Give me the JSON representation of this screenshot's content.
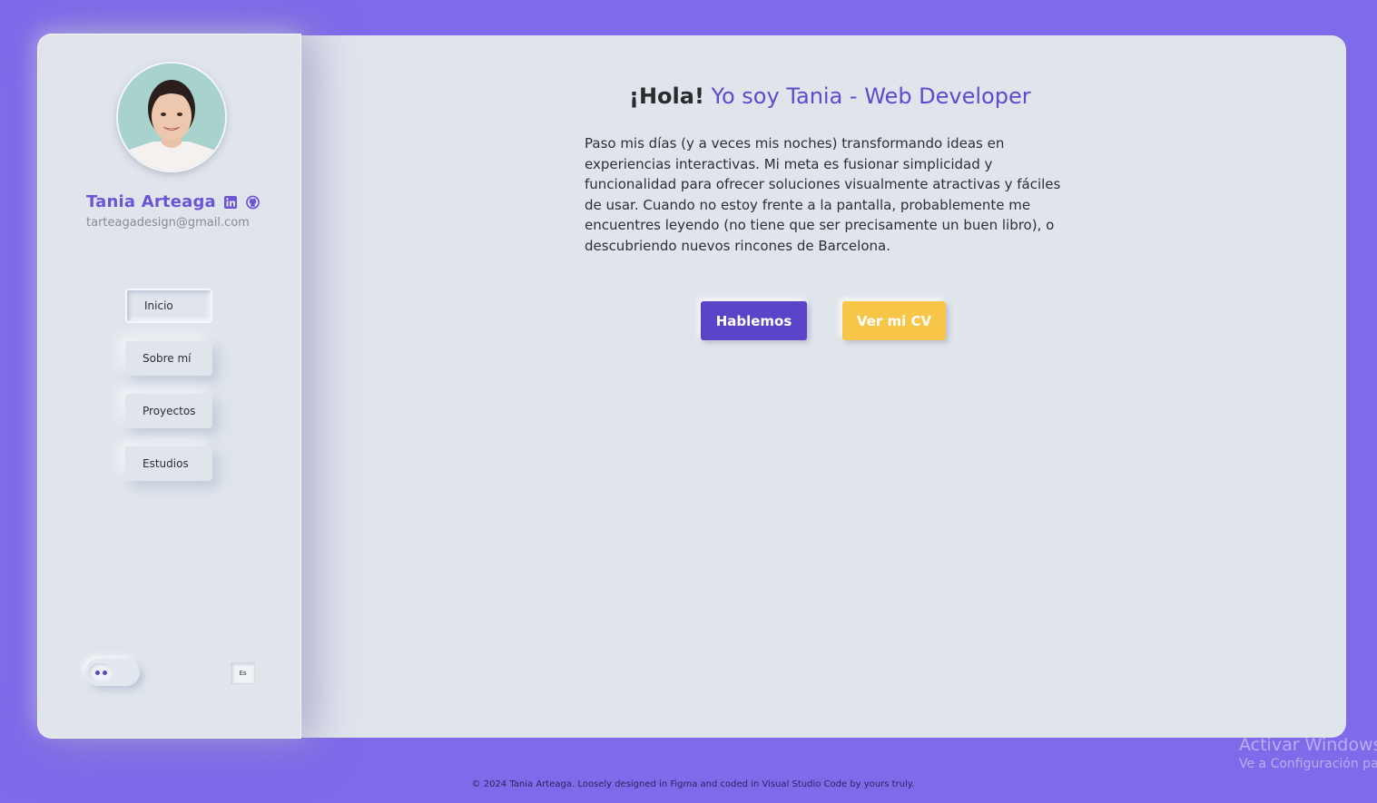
{
  "profile": {
    "name": "Tania Arteaga",
    "email": "tarteagadesign@gmail.com",
    "linkedin_icon": "linkedin-icon",
    "github_icon": "github-icon"
  },
  "nav": {
    "items": [
      {
        "label": "Inicio",
        "active": true
      },
      {
        "label": "Sobre mí",
        "active": false
      },
      {
        "label": "Proyectos",
        "active": false
      },
      {
        "label": "Estudios",
        "active": false
      }
    ]
  },
  "controls": {
    "theme_toggle_icon": "eyes-toggle-icon",
    "language": "Es"
  },
  "hero": {
    "greeting": "¡Hola!",
    "headline": " Yo soy Tania - Web Developer",
    "bio": "Paso mis días (y a veces mis noches) transformando ideas en experiencias interactivas. Mi meta es fusionar simplicidad y funcionalidad para ofrecer soluciones visualmente atractivas y fáciles de usar. Cuando no estoy frente a la pantalla, probablemente me encuentres leyendo (no tiene que ser precisamente un buen libro), o descubriendo nuevos rincones de Barcelona.",
    "primary_button": "Hablemos",
    "cv_button": "Ver mi CV"
  },
  "footer": {
    "text": "© 2024 Tania Arteaga. Loosely designed in Figma and coded in Visual Studio Code by yours truly."
  },
  "os_watermark": {
    "line1": "Activar Windows",
    "line2": "Ve a Configuración par"
  },
  "colors": {
    "background": "#7f6aea",
    "panel": "#e0e5ec",
    "accent": "#5b44c7",
    "cv_button": "#f7c548"
  }
}
